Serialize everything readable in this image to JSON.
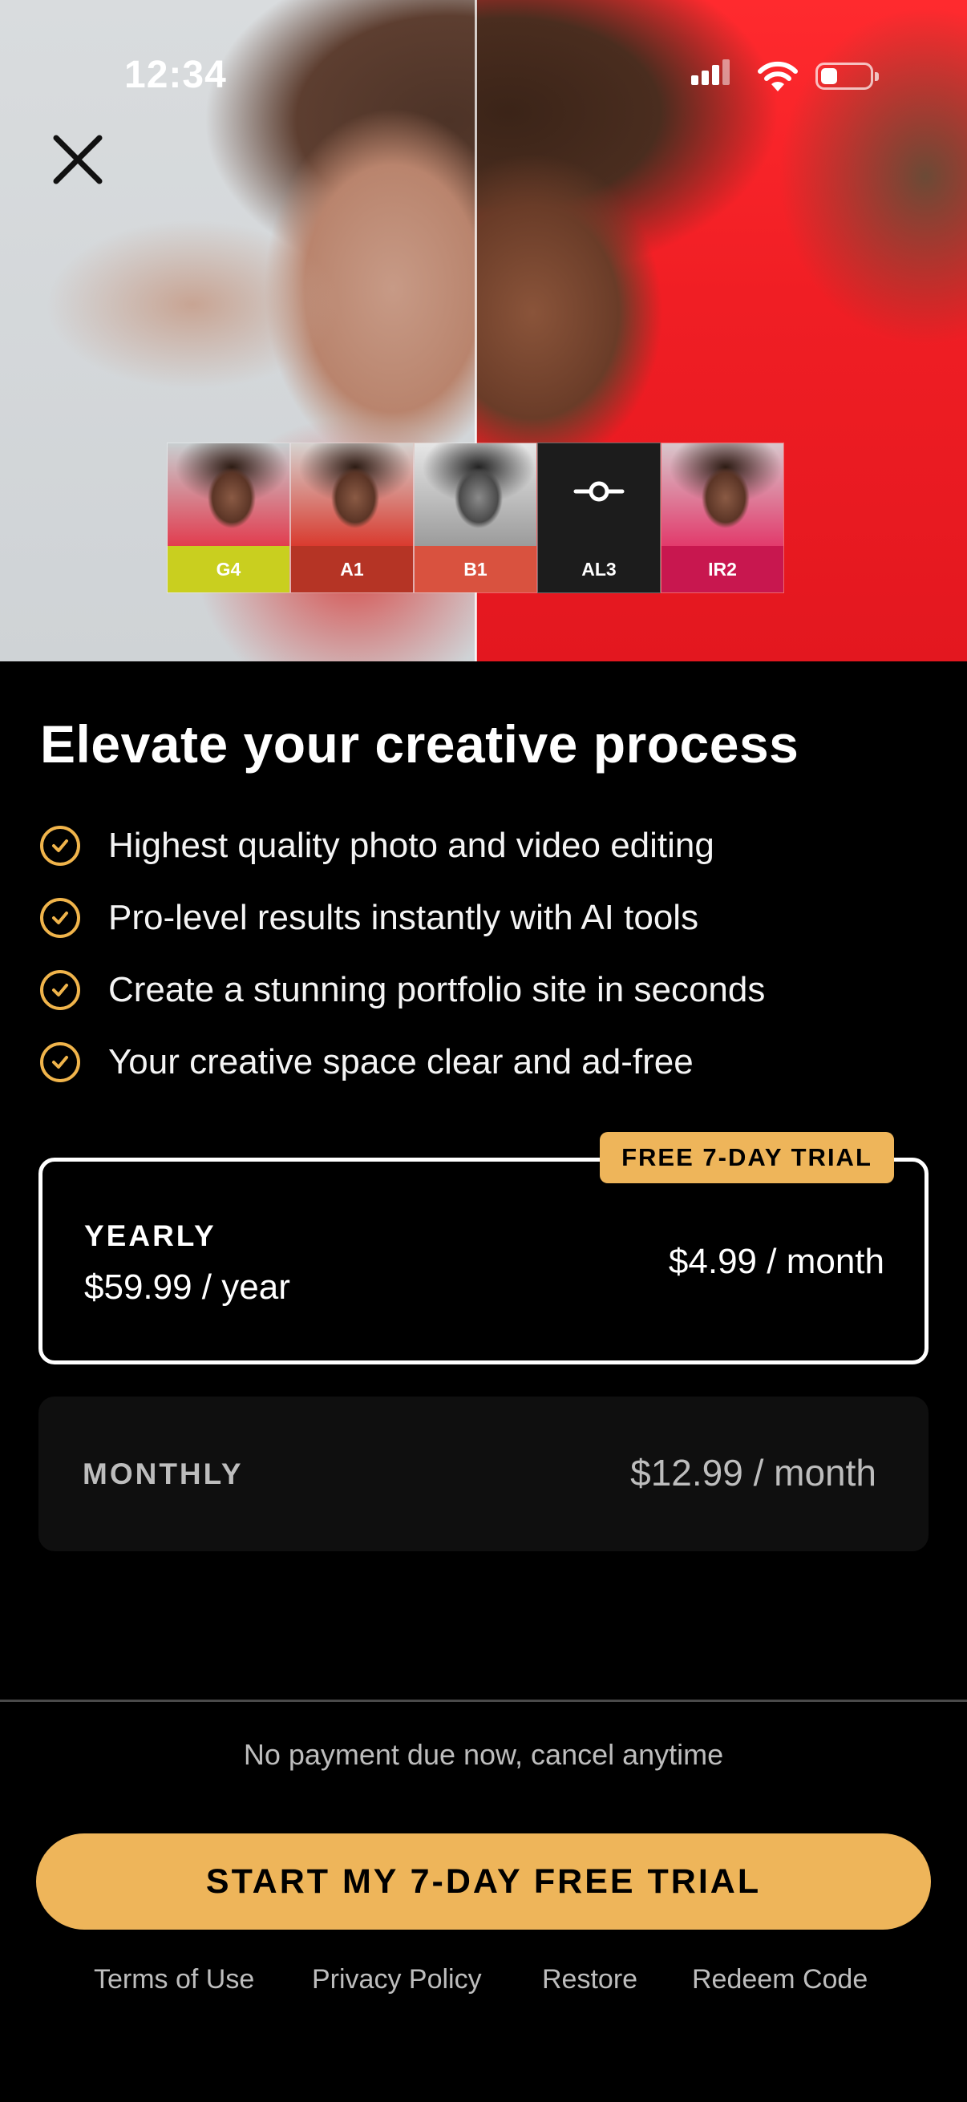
{
  "status_bar": {
    "time": "12:34"
  },
  "hero": {
    "filters": [
      {
        "label": "G4",
        "color": "#c9cf1f"
      },
      {
        "label": "A1",
        "color": "#b53425"
      },
      {
        "label": "B1",
        "color": "#d9523f"
      },
      {
        "label": "AL3",
        "color": "#1c1c1c",
        "icon": "adjust-slider-icon"
      },
      {
        "label": "IR2",
        "color": "#c8174f"
      }
    ]
  },
  "headline": "Elevate your creative process",
  "features": [
    "Highest quality photo and video editing",
    "Pro-level results instantly with AI tools",
    "Create a stunning portfolio site in seconds",
    "Your creative space clear and ad-free"
  ],
  "plans": {
    "yearly": {
      "badge": "FREE 7-DAY TRIAL",
      "name": "YEARLY",
      "price_year": "$59.99 / year",
      "price_month": "$4.99 / month",
      "selected": true
    },
    "monthly": {
      "name": "MONTHLY",
      "price_month": "$12.99 / month",
      "selected": false
    }
  },
  "note": "No payment due now, cancel anytime",
  "cta": "START MY 7-DAY FREE TRIAL",
  "footer": {
    "terms": "Terms of Use",
    "privacy": "Privacy Policy",
    "restore": "Restore",
    "redeem": "Redeem Code"
  },
  "colors": {
    "accent": "#eeb55a",
    "background": "#000000"
  }
}
